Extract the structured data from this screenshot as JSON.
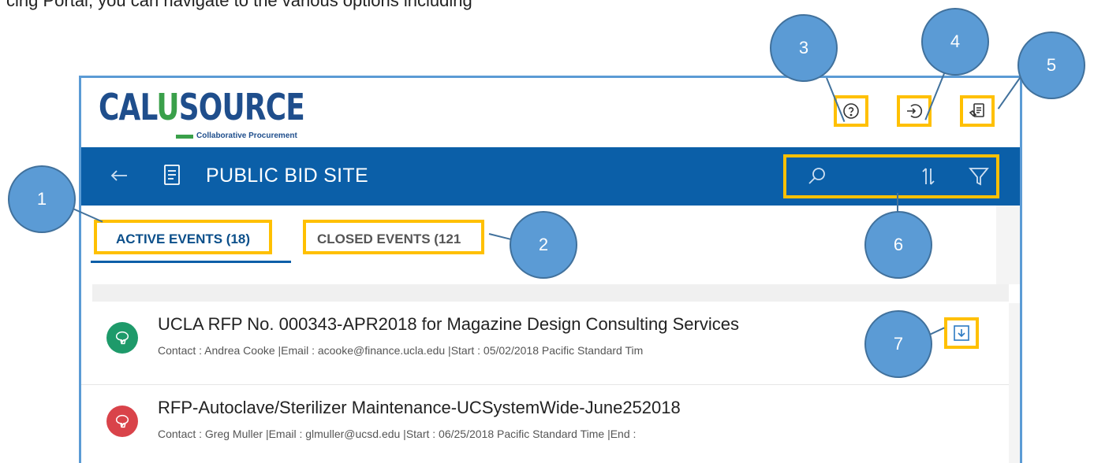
{
  "intro_text": "cing Portal, you can navigate to the various options including",
  "app": {
    "logo": {
      "word_a": "CAL",
      "word_u": "U",
      "word_b": "SOURCE",
      "tagline": "Collaborative Procurement"
    },
    "header_icons": [
      {
        "name": "help-icon"
      },
      {
        "name": "login-icon"
      },
      {
        "name": "register-icon"
      }
    ],
    "bar": {
      "title": "PUBLIC BID SITE"
    },
    "tools": [
      "search-icon",
      "sort-icon",
      "filter-icon"
    ],
    "tabs": [
      {
        "label": "ACTIVE EVENTS (18)",
        "active": true
      },
      {
        "label": "CLOSED EVENTS (121",
        "active": false
      }
    ],
    "events": [
      {
        "title": "UCLA RFP No. 000343-APR2018 for Magazine Design Consulting Services",
        "details": "Contact : Andrea Cooke |Email : acooke@finance.ucla.edu |Start : 05/02/2018 Pacific Standard Tim",
        "status_color": "#1e9a6a"
      },
      {
        "title": "RFP-Autoclave/Sterilizer Maintenance-UCSystemWide-June252018",
        "details": "Contact : Greg Muller |Email : glmuller@ucsd.edu |Start : 06/25/2018 Pacific Standard Time |End :",
        "status_color": "#d9434a"
      }
    ]
  },
  "callouts": [
    "1",
    "2",
    "3",
    "4",
    "5",
    "6",
    "7"
  ],
  "colors": {
    "brand_blue": "#0b5fa8",
    "highlight": "#ffc000",
    "callout": "#5b9bd5"
  }
}
